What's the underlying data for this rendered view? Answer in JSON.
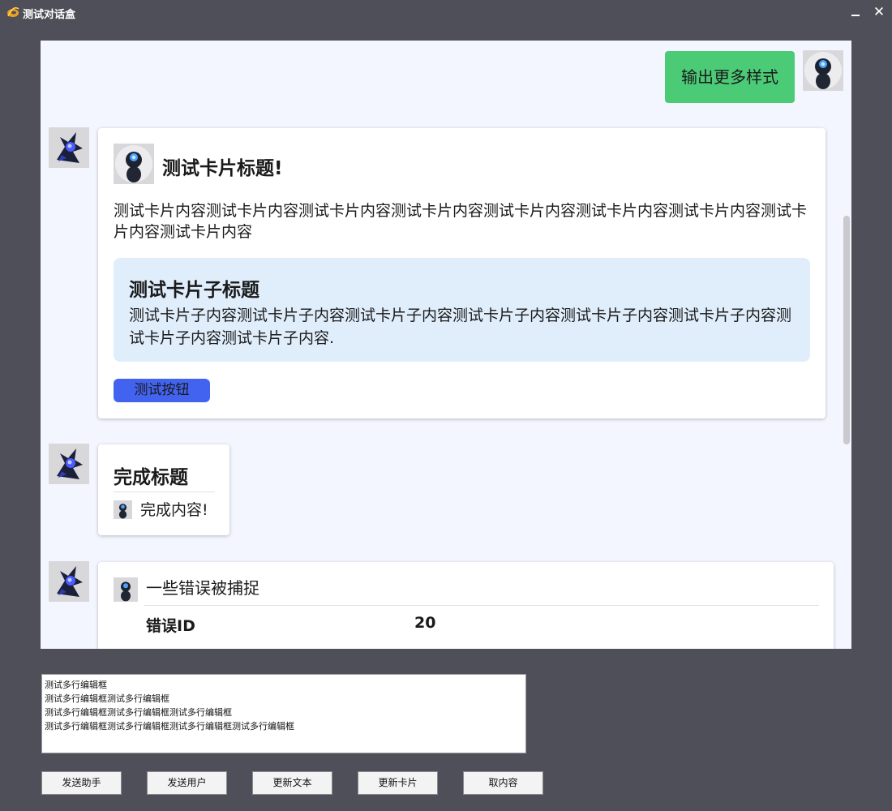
{
  "window": {
    "title": "测试对话盒",
    "minimize_glyph": "—",
    "close_glyph": "✕"
  },
  "chat": {
    "user_message": {
      "text": "输出更多样式",
      "avatar": "robot-avatar"
    },
    "card": {
      "title": "测试卡片标题!",
      "content": "测试卡片内容测试卡片内容测试卡片内容测试卡片内容测试卡片内容测试卡片内容测试卡片内容测试卡片内容测试卡片内容",
      "sub_title": "测试卡片子标题",
      "sub_content": "测试卡片子内容测试卡片子内容测试卡片子内容测试卡片子内容测试卡片子内容测试卡片子内容测试卡片子内容测试卡片子内容.",
      "button_label": "测试按钮"
    },
    "done_card": {
      "title": "完成标题",
      "content": "完成内容!"
    },
    "error_card": {
      "title": "一些错误被捕捉",
      "label": "错误ID",
      "value": "20"
    }
  },
  "editor": {
    "value": "测试多行编辑框\n测试多行编辑框测试多行编辑框\n测试多行编辑框测试多行编辑框测试多行编辑框\n测试多行编辑框测试多行编辑框测试多行编辑框测试多行编辑框"
  },
  "buttons": {
    "send_assistant": "发送助手",
    "send_user": "发送用户",
    "update_text": "更新文本",
    "update_card": "更新卡片",
    "get_content": "取内容"
  },
  "colors": {
    "background": "#4f4f59",
    "chat_background": "#f3f6ff",
    "user_bubble": "#4ccb76",
    "sub_card": "#e0eefc",
    "primary_button": "#4263f0"
  }
}
